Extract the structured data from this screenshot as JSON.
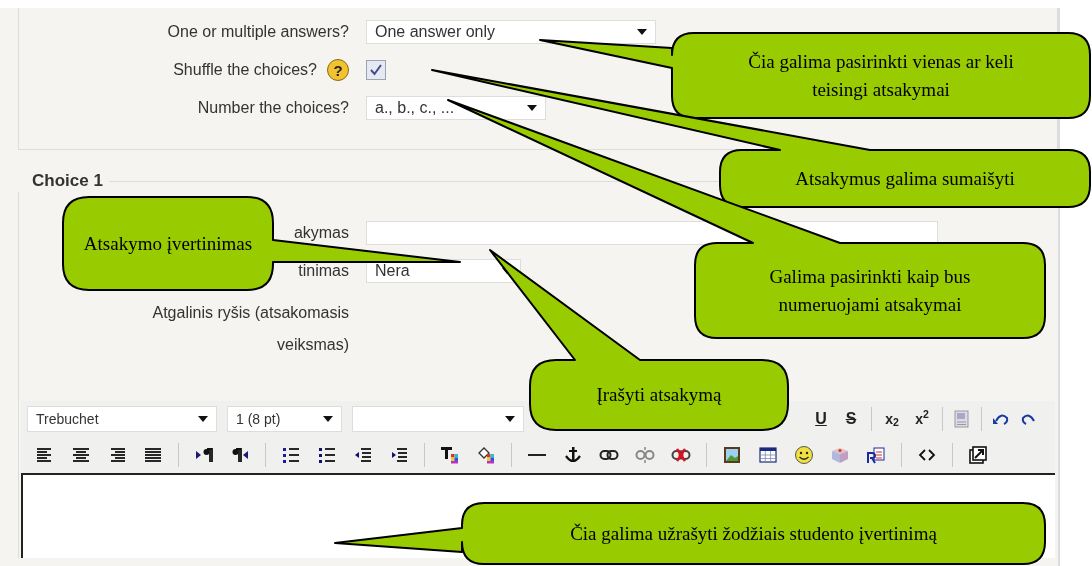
{
  "settings": [
    {
      "label": "One or multiple answers?",
      "kind": "select",
      "value": "One answer only"
    },
    {
      "label": "Shuffle the choices?",
      "help_icon": "?",
      "kind": "checkbox",
      "checked": true
    },
    {
      "label": "Number the choices?",
      "kind": "select",
      "value": "a., b., c., ..."
    }
  ],
  "choice": {
    "legend": "Choice 1",
    "rows": [
      {
        "label": "akymas",
        "kind": "text"
      },
      {
        "label": "tinimas",
        "kind": "select",
        "value": "Nera"
      },
      {
        "label": "Atgalinis ryšis (atsakomasis veiksmas)",
        "kind": "label"
      }
    ]
  },
  "editor": {
    "selects": [
      {
        "kind": "font",
        "value": "Trebuchet"
      },
      {
        "kind": "size",
        "value": "1 (8 pt)"
      },
      {
        "kind": "format"
      }
    ],
    "row_1_groups": [
      [
        {
          "kind": "underline",
          "label": "U"
        },
        {
          "kind": "strike",
          "label": "S"
        }
      ],
      [
        {
          "kind": "subscript",
          "label": "x$_{2}$"
        },
        {
          "kind": "superscript",
          "label": "x$^{2}$"
        }
      ],
      [
        {
          "kind": "word"
        }
      ],
      [
        {
          "kind": "undo"
        },
        {
          "kind": "redo"
        }
      ]
    ],
    "row_2_groups": [
      [
        {
          "kind": "align-left"
        },
        {
          "kind": "align-center"
        },
        {
          "kind": "align-right"
        },
        {
          "kind": "justify"
        }
      ],
      [
        {
          "kind": "ltr"
        },
        {
          "kind": "rtl"
        }
      ],
      [
        {
          "kind": "ordered-list"
        },
        {
          "kind": "bullet-list"
        },
        {
          "kind": "outdent"
        },
        {
          "kind": "indent"
        }
      ],
      [
        {
          "kind": "text-color"
        },
        {
          "kind": "fill-color"
        }
      ],
      [
        {
          "kind": "rule"
        },
        {
          "kind": "anchor"
        },
        {
          "kind": "link"
        },
        {
          "kind": "unlink"
        },
        {
          "kind": "remove-link"
        }
      ],
      [
        {
          "kind": "image"
        },
        {
          "kind": "table"
        },
        {
          "kind": "smiley"
        },
        {
          "kind": "cube"
        },
        {
          "kind": "paste"
        }
      ],
      [
        {
          "kind": "code"
        }
      ],
      [
        {
          "kind": "fullscreen"
        }
      ]
    ]
  },
  "callouts": [
    {
      "text": "Čia galima pasirinkti vienas ar keli teisingi atsakymai"
    },
    {
      "text": "Atsakymus galima sumaišyti"
    },
    {
      "text": "Galima pasirinkti kaip bus numeruojami atsakymai"
    },
    {
      "text": "Atsakymo įvertinimas"
    },
    {
      "text": "Įrašyti atsakymą"
    },
    {
      "text": "Čia galima užrašyti žodžiais studento įvertinimą"
    }
  ]
}
